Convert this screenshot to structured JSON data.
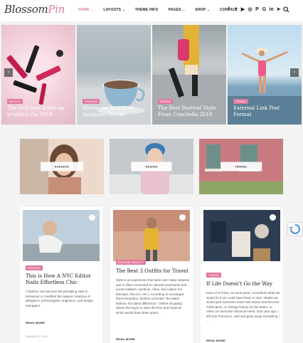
{
  "header": {
    "logo_main": "Blossom",
    "logo_accent": "Pin",
    "nav": [
      {
        "label": "HOME",
        "dropdown": true
      },
      {
        "label": "LAYOUTS",
        "dropdown": true
      },
      {
        "label": "THEME INFO",
        "dropdown": false
      },
      {
        "label": "PAGES",
        "dropdown": true
      },
      {
        "label": "SHOP",
        "dropdown": true
      },
      {
        "label": "CONTACT",
        "dropdown": false
      }
    ],
    "social_icons": [
      "facebook-icon",
      "twitter-icon",
      "youtube-icon",
      "instagram-icon",
      "pinterest-icon",
      "google-plus-icon",
      "linkedin-icon",
      "telegram-icon"
    ]
  },
  "slider": {
    "slides": [
      {
        "category": "BEAUTY",
        "title": "The best new make-up products for 2018"
      },
      {
        "category": "FASHION",
        "title": "Moroccan Smacking doughnut Recipe"
      },
      {
        "category": "DESIGN",
        "title": "The Best Festival Style From Coachella 2018"
      },
      {
        "category": "TRAVEL",
        "title": "External Link Post Format"
      }
    ]
  },
  "categories": [
    {
      "label": "FASHION"
    },
    {
      "label": "DESIGN"
    },
    {
      "label": "TRAVEL"
    }
  ],
  "posts": [
    {
      "category": "FASHION",
      "title": "This is How A NYC Editor Nails Effortless Chic",
      "excerpt": "A fashion can become the prevailing style in behaviour or manifest the newest creations of designers, technologists, engineers, and design managers.",
      "read_more": "READ MORE",
      "date": "JANUARY 22, 2019"
    },
    {
      "category": "FASHION, BEAUTY",
      "title": "The Best 3 Outfits for Travel",
      "excerpt": "Style is an expression that lasts over many seasons and is often connected to cultural movements and social markers, symbols, class, and culture (ex. Baroque, Rococo, etc.). According to sociologist Pierre Bourdieu, fashion connotes \"the latest fashion, the latest difference.\" Online shopping allows the buyer to save the time and expense which would have been spent...",
      "read_more": "READ MORE",
      "date": ""
    },
    {
      "category": "TRAVEL",
      "title": "If Life Doesn't Go the Way",
      "excerpt": "Most of us have, at some point, considered what we would do if we could travel back in time. Maybe we would give ourselves some fast advice and become millionaires, or change history for the better, or relive our favourite historical event. One year ago, I left San Francisco, sold and gave away everything I ...",
      "read_more": "READ MORE",
      "date": ""
    }
  ],
  "colors": {
    "accent": "#e27aa0"
  }
}
